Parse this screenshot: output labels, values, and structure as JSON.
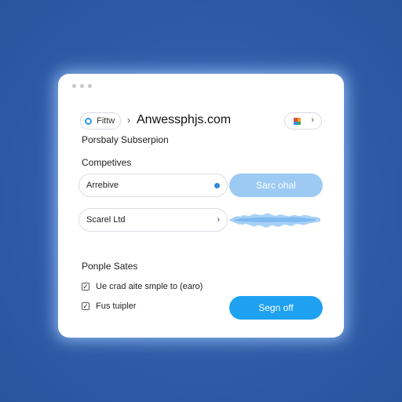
{
  "browser": {
    "site_label": "Fittw",
    "domain": "Anwessphjs.com"
  },
  "section_heading": "Porsbaly Subserpion",
  "competives": {
    "label": "Competives",
    "input_value": "Arrebive",
    "button_label": "Sarc ohal"
  },
  "secondary": {
    "input_value": "Scarel Ltd"
  },
  "people_sates": {
    "label": "Ponple Sates",
    "options": [
      {
        "label": "Ue crad aite smple to (earo)",
        "checked": true
      },
      {
        "label": "Fus tuipler",
        "checked": true
      }
    ],
    "button_label": "Segn off"
  },
  "colors": {
    "background": "#2f5aa6",
    "accent": "#1ea1f1",
    "accent_light": "#9ccaf3"
  }
}
